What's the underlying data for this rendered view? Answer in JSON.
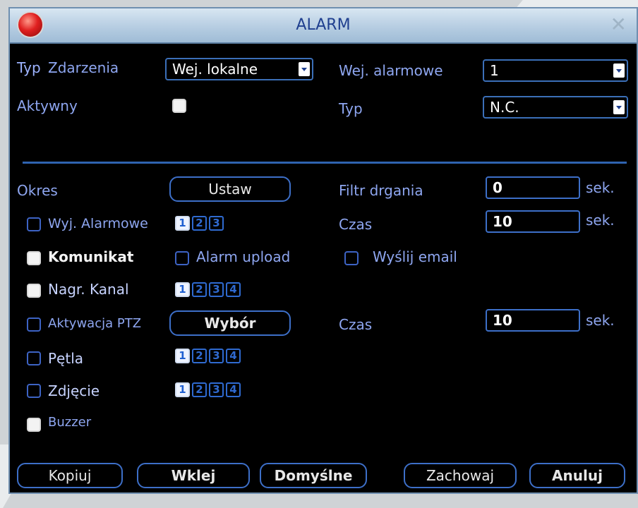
{
  "window": {
    "title": "ALARM"
  },
  "event": {
    "type_label_1": "Typ",
    "type_label_2": "Zdarzenia",
    "type_value": "Wej. lokalne",
    "active_label": "Aktywny",
    "input_label": "Wej. alarmowe",
    "input_value": "1",
    "type2_label": "Typ",
    "type2_value": "N.C."
  },
  "period": {
    "label": "Okres",
    "button": "Ustaw"
  },
  "filter": {
    "label": "Filtr drgania",
    "value": "0",
    "unit": "sek."
  },
  "alarm_output": {
    "label": "Wyj. Alarmowe",
    "numbers": [
      "1",
      "2",
      "3"
    ]
  },
  "delay": {
    "label": "Czas",
    "value": "10",
    "unit": "sek."
  },
  "message": {
    "label": "Komunikat"
  },
  "alarm_upload": {
    "label": "Alarm upload"
  },
  "send_email": {
    "label": "Wyślij email"
  },
  "record": {
    "label": "Nagr. Kanal",
    "numbers": [
      "1",
      "2",
      "3",
      "4"
    ]
  },
  "ptz": {
    "label": "Aktywacja PTZ",
    "button": "Wybór"
  },
  "ptz_time": {
    "label": "Czas",
    "value": "10",
    "unit": "sek."
  },
  "tour": {
    "label": "Pętla",
    "numbers": [
      "1",
      "2",
      "3",
      "4"
    ]
  },
  "snapshot": {
    "label": "Zdjęcie",
    "numbers": [
      "1",
      "2",
      "3",
      "4"
    ]
  },
  "buzzer": {
    "label": "Buzzer"
  },
  "footer": {
    "copy": "Kopiuj",
    "paste": "Wklej",
    "default": "Domyślne",
    "save": "Zachowaj",
    "cancel": "Anuluj"
  },
  "colors": {
    "accent": "#3d6fc8",
    "label": "#8ea6f0",
    "title": "#1f3f8f"
  }
}
